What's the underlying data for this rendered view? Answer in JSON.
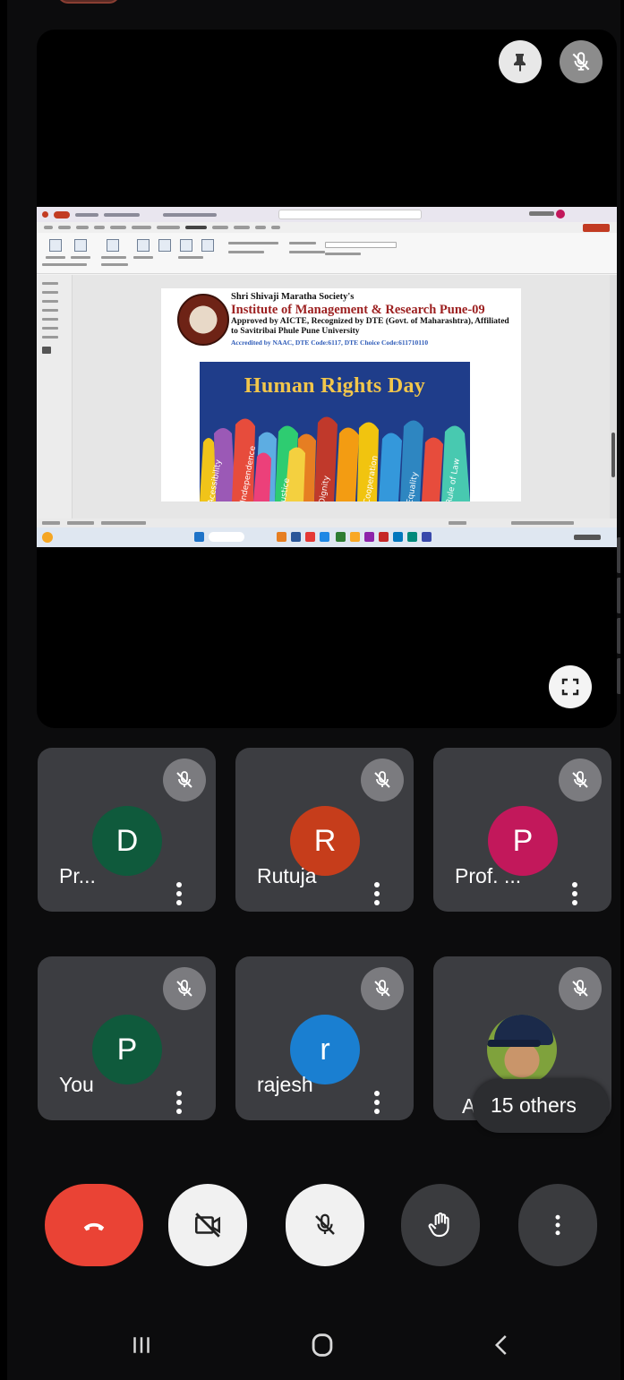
{
  "slide": {
    "society": "Shri Shivaji Maratha Society's",
    "institute": "Institute of Management & Research Pune-09",
    "approved": "Approved by AICTE, Recognized by DTE (Govt. of Maharashtra), Affiliated to Savitribai Phule Pune University",
    "accredited": "Accredited by NAAC, DTE Code:6117, DTE Choice Code:611710110",
    "poster_title": "Human Rights Day",
    "poster_words": [
      "Acessibility",
      "Independence",
      "Justice",
      "Dignity",
      "Cooperation",
      "Equality",
      "Rule of Law"
    ]
  },
  "participants": [
    {
      "name": "Pr...",
      "initial": "D",
      "avatar_color": "#0f5a3c",
      "muted": true
    },
    {
      "name": "Rutuja",
      "initial": "R",
      "avatar_color": "#c63d1b",
      "muted": true
    },
    {
      "name": "Prof. ...",
      "initial": "P",
      "avatar_color": "#c2185b",
      "muted": true
    },
    {
      "name": "You",
      "initial": "P",
      "avatar_color": "#0f5a3c",
      "muted": true
    },
    {
      "name": "rajesh",
      "initial": "r",
      "avatar_color": "#1a7fd1",
      "muted": true
    },
    {
      "name": "Ad",
      "initial": "",
      "avatar_color": "#7fa23c",
      "muted": true,
      "photo": true
    }
  ],
  "others_label": "15 others",
  "colors": {
    "end_call": "#ea4335",
    "tile_bg": "#3c3d41",
    "mute_badge": "#7b7b7f"
  },
  "icons": {
    "pin": "pin-icon",
    "mic_off": "mic-off-icon",
    "fullscreen": "fullscreen-icon",
    "end_call": "phone-hangup-icon",
    "camera_off": "video-off-icon",
    "raise_hand": "hand-icon",
    "more": "more-vertical-icon",
    "nav_recents": "recents-icon",
    "nav_home": "home-icon",
    "nav_back": "back-icon"
  }
}
